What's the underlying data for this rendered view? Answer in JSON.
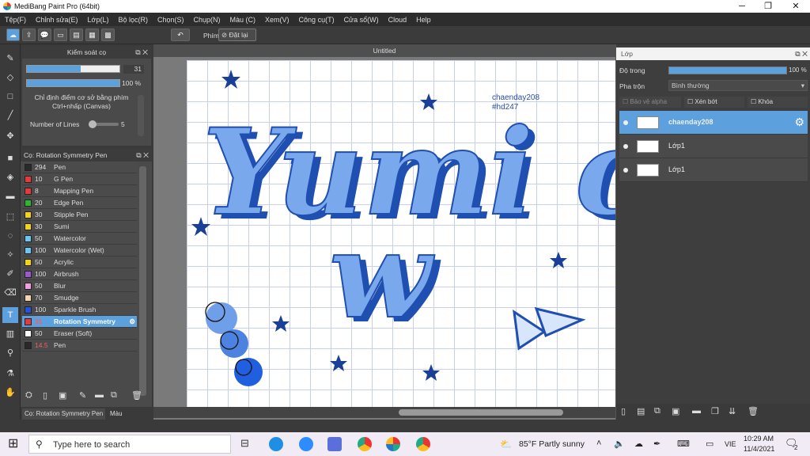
{
  "window": {
    "title": "MediBang Paint Pro (64bit)"
  },
  "menu": [
    "Tệp(F)",
    "Chỉnh sửa(E)",
    "Lớp(L)",
    "Bộ lọc(R)",
    "Chọn(S)",
    "Chụp(N)",
    "Màu (C)",
    "Xem(V)",
    "Công cụ(T)",
    "Cửa sổ(W)",
    "Cloud",
    "Help"
  ],
  "toolbar": {
    "key_label": "Phím",
    "reset_label": "Đặt lại"
  },
  "brush_control": {
    "title": "Kiểm soát cọ",
    "size_value": "31",
    "opacity_value": "100 %",
    "size_fraction": 0.58,
    "opacity_fraction": 1.0,
    "hint": "Chỉ định điểm cơ sở bằng phím Ctrl+nhấp (Canvas)",
    "lines_label": "Number of Lines",
    "lines_value": "5"
  },
  "brush_panel": {
    "title": "Cọ: Rotation Symmetry Pen",
    "brushes": [
      {
        "size": "294",
        "name": "Pen",
        "color": "#2a2a2a"
      },
      {
        "size": "10",
        "name": "G Pen",
        "color": "#e83a3a"
      },
      {
        "size": "8",
        "name": "Mapping Pen",
        "color": "#e83a3a"
      },
      {
        "size": "20",
        "name": "Edge Pen",
        "color": "#2eb82e"
      },
      {
        "size": "30",
        "name": "Stipple Pen",
        "color": "#f2d21a"
      },
      {
        "size": "30",
        "name": "Sumi",
        "color": "#f2d21a"
      },
      {
        "size": "50",
        "name": "Watercolor",
        "color": "#6cc7f0"
      },
      {
        "size": "100",
        "name": "Watercolor (Wet)",
        "color": "#6cc7f0"
      },
      {
        "size": "50",
        "name": "Acrylic",
        "color": "#f2d21a"
      },
      {
        "size": "100",
        "name": "Airbrush",
        "color": "#9b59d0"
      },
      {
        "size": "50",
        "name": "Blur",
        "color": "#f0a0e0"
      },
      {
        "size": "70",
        "name": "Smudge",
        "color": "#f5d5b0"
      },
      {
        "size": "100",
        "name": "Sparkle Brush",
        "color": "#2255dd"
      },
      {
        "size": "31",
        "name": "Rotation Symmetry",
        "color": "#e83a3a",
        "selected": true
      },
      {
        "size": "50",
        "name": "Eraser (Soft)",
        "color": "#ffffff"
      },
      {
        "size": "14.5",
        "name": "Pen",
        "color": "#2a2a2a"
      }
    ],
    "bottom_tab": "Cọ: Rotation Symmetry Pen",
    "bottom_tab2": "Màu"
  },
  "canvas": {
    "title": "Untitled",
    "signature": "chaenday208",
    "hashtag": "#hd247",
    "text_line1": "Yumi ch",
    "text_line2": "w"
  },
  "layers": {
    "title": "Lớp",
    "opacity_label": "Độ trong",
    "opacity_value": "100 %",
    "opacity_fraction": 1.0,
    "blend_label": "Pha trộn",
    "blend_value": "Bình thường",
    "protect_alpha": "Bảo vệ alpha",
    "clipping": "Xén bớt",
    "lock": "Khóa",
    "items": [
      {
        "name": "chaenday208",
        "selected": true
      },
      {
        "name": "Lớp1"
      },
      {
        "name": "Lớp1"
      }
    ]
  },
  "taskbar": {
    "search_placeholder": "Type here to search",
    "weather": "85°F  Partly sunny",
    "lang": "VIE",
    "time": "10:29 AM",
    "date": "11/4/2021",
    "notifications": "2"
  },
  "colors": {
    "accent": "#5da0de",
    "letter_fill": "#7aa8ec",
    "letter_shadow": "#1f4fb0",
    "star": "#1a3f96"
  }
}
